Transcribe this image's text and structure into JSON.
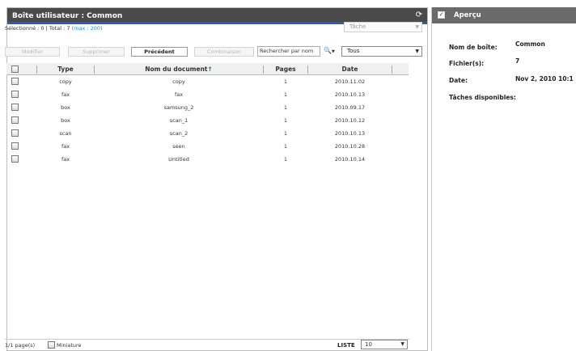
{
  "left_panel": {
    "title": "Boîte utilisateur : Common",
    "status": {
      "selected": "Sélectionné : 0",
      "sep": " | ",
      "total": "Total : 7",
      "max": "(max : 200)"
    },
    "task_select": "Tâche",
    "buttons": {
      "modify": "Modifier",
      "delete": "Supprimer",
      "previous": "Précédent",
      "combine": "Combinaison"
    },
    "search": {
      "placeholder": "Rechercher par nom",
      "value": "Rechercher par nom"
    },
    "filter_select": "Tous",
    "table": {
      "headers": {
        "type": "Type",
        "name": "Nom du document",
        "sort_icon": "↑",
        "pages": "Pages",
        "date": "Date"
      },
      "rows": [
        {
          "type": "copy",
          "name": "copy",
          "pages": "1",
          "date": "2010.11.02"
        },
        {
          "type": "fax",
          "name": "fax",
          "pages": "1",
          "date": "2010.10.13"
        },
        {
          "type": "box",
          "name": "samsung_2",
          "pages": "1",
          "date": "2010.09.17"
        },
        {
          "type": "box",
          "name": "scan_1",
          "pages": "1",
          "date": "2010.10.12"
        },
        {
          "type": "scan",
          "name": "scan_2",
          "pages": "1",
          "date": "2010.10.13"
        },
        {
          "type": "fax",
          "name": "seen",
          "pages": "1",
          "date": "2010.10.28"
        },
        {
          "type": "fax",
          "name": "Untitled",
          "pages": "1",
          "date": "2010.10.14"
        }
      ]
    },
    "footer": {
      "pages": "1/1 page(s)",
      "thumbnail_label": "Miniature",
      "list_label": "LISTE",
      "list_size": "10"
    }
  },
  "right_panel": {
    "title": "Aperçu",
    "fields": {
      "box_name_label": "Nom de boîte:",
      "box_name_value": "Common",
      "files_label": "Fichier(s):",
      "files_value": "7",
      "date_label": "Date:",
      "date_value": "Nov 2, 2010 10:1",
      "tasks_label": "Tâches disponibles:"
    }
  },
  "colors": {
    "header_bg": "#4a4a4a",
    "accent": "#2a5db0",
    "link": "#2a8de0"
  }
}
